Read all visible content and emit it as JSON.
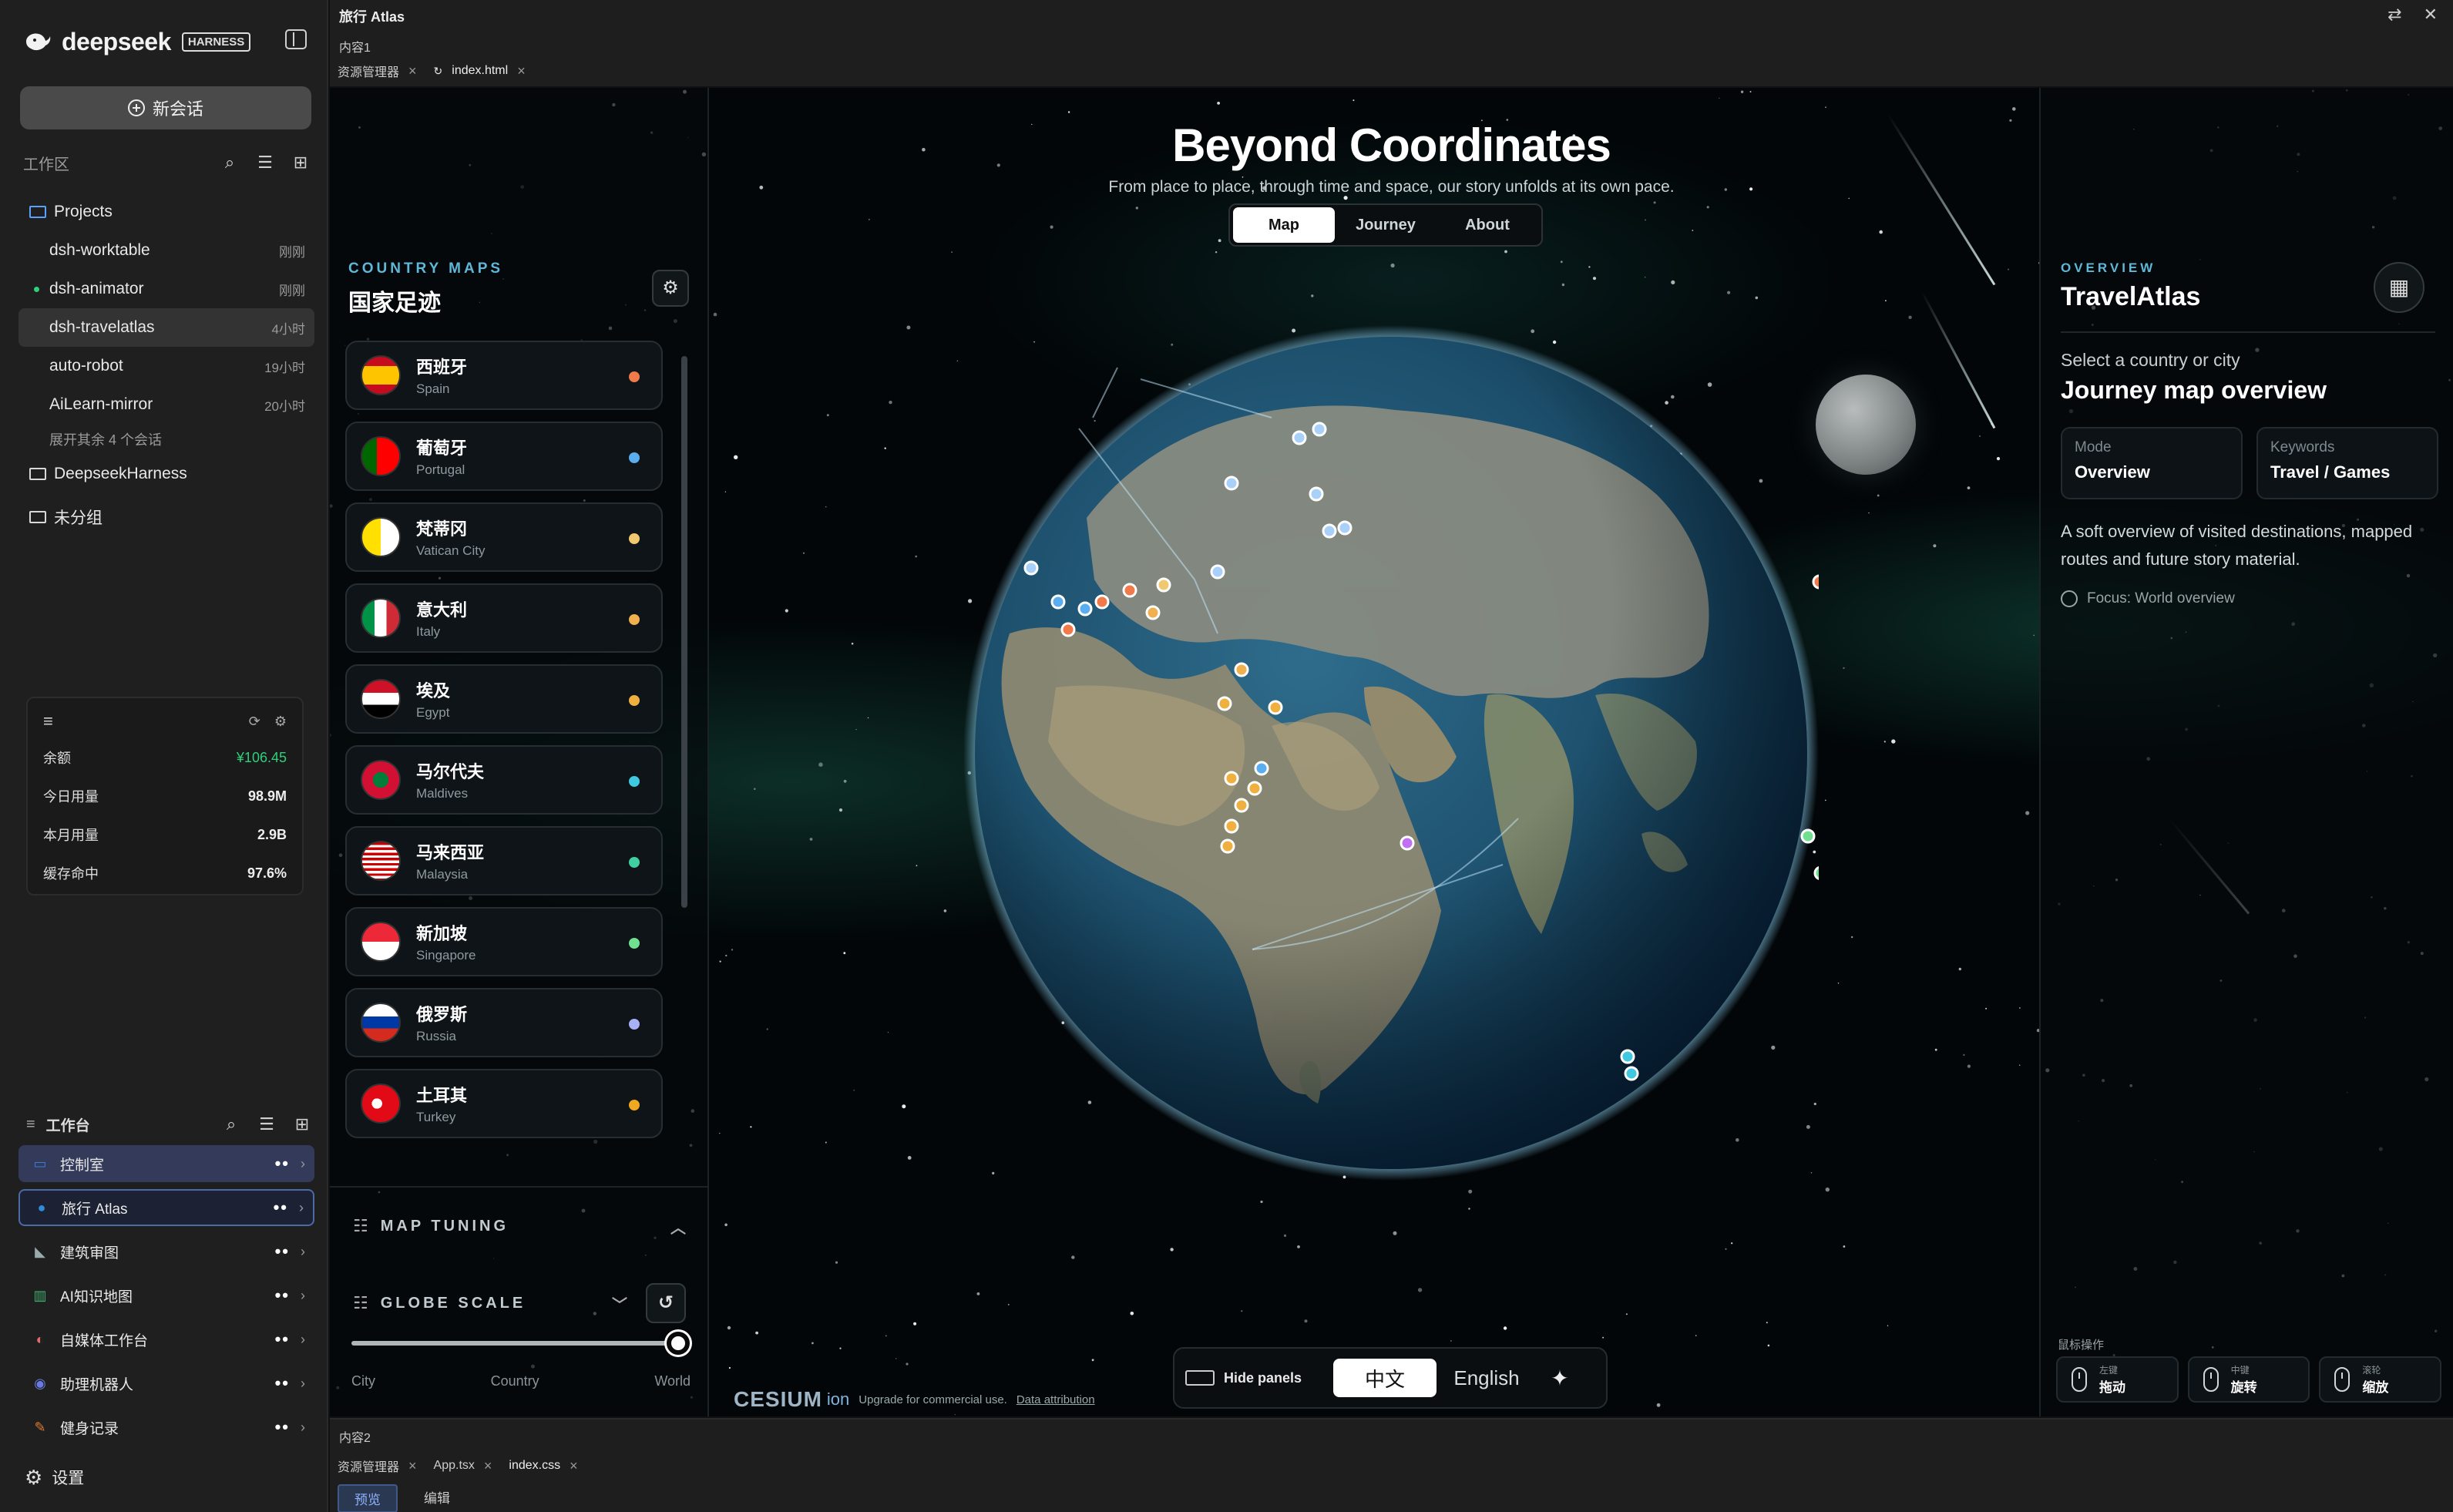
{
  "sidebar": {
    "brand": {
      "name": "deepseek",
      "badge": "HARNESS"
    },
    "new_chat": "新会话",
    "workspace_label": "工作区",
    "folders": [
      {
        "label": "Projects",
        "projects": [
          {
            "name": "dsh-worktable",
            "time": "刚刚",
            "dot": false,
            "active": false
          },
          {
            "name": "dsh-animator",
            "time": "刚刚",
            "dot": true,
            "active": false
          },
          {
            "name": "dsh-travelatlas",
            "time": "4小时",
            "dot": false,
            "active": true
          },
          {
            "name": "auto-robot",
            "time": "19小时",
            "dot": false,
            "active": false
          },
          {
            "name": "AiLearn-mirror",
            "time": "20小时",
            "dot": false,
            "active": false
          }
        ],
        "more": "展开其余 4 个会话"
      },
      {
        "label": "DeepseekHarness"
      },
      {
        "label": "未分组"
      }
    ],
    "usage": {
      "menu_icon": "≡",
      "rows": [
        {
          "k": "余额",
          "v": "¥106.45",
          "green": true
        },
        {
          "k": "今日用量",
          "v": "98.9M",
          "green": false
        },
        {
          "k": "本月用量",
          "v": "2.9B",
          "green": false
        },
        {
          "k": "缓存命中",
          "v": "97.6%",
          "green": false
        }
      ]
    },
    "bench_label": "工作台",
    "bench": [
      {
        "label": "控制室",
        "icon": "monitor-icon",
        "state": "active1"
      },
      {
        "label": "旅行 Atlas",
        "icon": "globe-icon",
        "state": "active2"
      },
      {
        "label": "建筑审图",
        "icon": "ruler-icon",
        "state": ""
      },
      {
        "label": "AI知识地图",
        "icon": "chart-icon",
        "state": ""
      },
      {
        "label": "自媒体工作台",
        "icon": "palette-icon",
        "state": ""
      },
      {
        "label": "助理机器人",
        "icon": "robot-icon",
        "state": ""
      },
      {
        "label": "健身记录",
        "icon": "pencil-icon",
        "state": ""
      }
    ],
    "settings": "设置"
  },
  "topbar": {
    "title": "旅行 Atlas",
    "pane_label": "内容1",
    "tabs": [
      "资源管理器",
      "index.html"
    ]
  },
  "view": {
    "title": "Beyond Coordinates",
    "subtitle": "From place to place, through time and space, our story unfolds at its own pace.",
    "mode_tabs": [
      "Map",
      "Journey",
      "About"
    ],
    "active_mode": "Map"
  },
  "left_panel": {
    "kicker": "COUNTRY MAPS",
    "title": "国家足迹",
    "countries": [
      {
        "zh": "西班牙",
        "en": "Spain",
        "dot": "#f07a4a"
      },
      {
        "zh": "葡萄牙",
        "en": "Portugal",
        "dot": "#5aaef0"
      },
      {
        "zh": "梵蒂冈",
        "en": "Vatican City",
        "dot": "#f0c870"
      },
      {
        "zh": "意大利",
        "en": "Italy",
        "dot": "#f0b050"
      },
      {
        "zh": "埃及",
        "en": "Egypt",
        "dot": "#f0b040"
      },
      {
        "zh": "马尔代夫",
        "en": "Maldives",
        "dot": "#40c8e0"
      },
      {
        "zh": "马来西亚",
        "en": "Malaysia",
        "dot": "#40d0a0"
      },
      {
        "zh": "新加坡",
        "en": "Singapore",
        "dot": "#70e090"
      },
      {
        "zh": "俄罗斯",
        "en": "Russia",
        "dot": "#a8b0f8"
      },
      {
        "zh": "土耳其",
        "en": "Turkey",
        "dot": "#f0a820"
      }
    ],
    "tuning_label": "MAP TUNING",
    "scale_label": "GLOBE SCALE",
    "scale_value": 1.0,
    "scale_ticks": [
      "City",
      "Country",
      "World"
    ],
    "attribution": {
      "logo": "CESIUM",
      "ion": "ion",
      "upgrade": "Upgrade for commercial use.",
      "link": "Data attribution"
    }
  },
  "right_panel": {
    "kicker": "OVERVIEW",
    "title": "TravelAtlas",
    "select_hint": "Select a country or city",
    "heading": "Journey map overview",
    "cards": [
      {
        "k": "Mode",
        "v": "Overview"
      },
      {
        "k": "Keywords",
        "v": "Travel / Games"
      }
    ],
    "description": "A soft overview of visited destinations, mapped routes and future story material.",
    "focus": "Focus: World overview",
    "mouse_label": "鼠标操作",
    "mouse": [
      {
        "l1": "左键",
        "l2": "拖动"
      },
      {
        "l1": "中键",
        "l2": "旋转"
      },
      {
        "l1": "滚轮",
        "l2": "缩放"
      }
    ]
  },
  "bottom_bar": {
    "hide_panels": "Hide panels",
    "zh": "中文",
    "en": "English"
  },
  "bottom_pane": {
    "label": "内容2",
    "tabs": [
      "资源管理器",
      "App.tsx",
      "index.css"
    ],
    "segments": [
      "预览",
      "编辑"
    ]
  }
}
